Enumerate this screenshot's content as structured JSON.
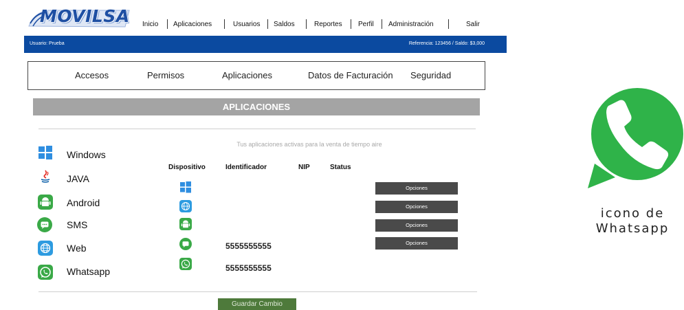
{
  "brand": {
    "logo_text": "MOVILSA"
  },
  "topnav": [
    "Inicio",
    "Aplicaciones",
    "Usuarios",
    "Saldos",
    "Reportes",
    "Perfil",
    "Administración",
    "Salir"
  ],
  "userbar": {
    "user": "Usuario: Prueba",
    "reference": "Referencia: 123456 / Saldo: $3,000"
  },
  "tabs": [
    "Accesos",
    "Permisos",
    "Aplicaciones",
    "Datos de Facturación",
    "Seguridad"
  ],
  "section_title": "APLICACIONES",
  "subtitle": "Tus aplicaciones activas para la venta de tiempo aire",
  "devices": [
    {
      "label": "Windows",
      "icon": "windows-icon"
    },
    {
      "label": "JAVA",
      "icon": "java-icon"
    },
    {
      "label": "Android",
      "icon": "android-icon"
    },
    {
      "label": "SMS",
      "icon": "sms-icon"
    },
    {
      "label": "Web",
      "icon": "web-icon"
    },
    {
      "label": "Whatsapp",
      "icon": "whatsapp-icon"
    }
  ],
  "table": {
    "headers": [
      "Dispositivo",
      "Identificador",
      "NIP",
      "Status"
    ],
    "rows": [
      {
        "device_icon": "windows-icon",
        "identifier": ""
      },
      {
        "device_icon": "web-icon",
        "identifier": ""
      },
      {
        "device_icon": "android-icon",
        "identifier": ""
      },
      {
        "device_icon": "sms-icon",
        "identifier": "5555555555"
      },
      {
        "device_icon": "whatsapp-icon",
        "identifier": "5555555555"
      }
    ],
    "options_label": "Opciones"
  },
  "save_label": "Guardar Cambio",
  "whatsapp_caption": {
    "line1": "icono de",
    "line2": "Whatsapp"
  },
  "colors": {
    "brand_blue": "#0b4aa0",
    "section_gray": "#a4a4a4",
    "button_dark": "#4a4a4a",
    "save_green": "#4e7a3b",
    "whatsapp_green": "#2fb349"
  }
}
